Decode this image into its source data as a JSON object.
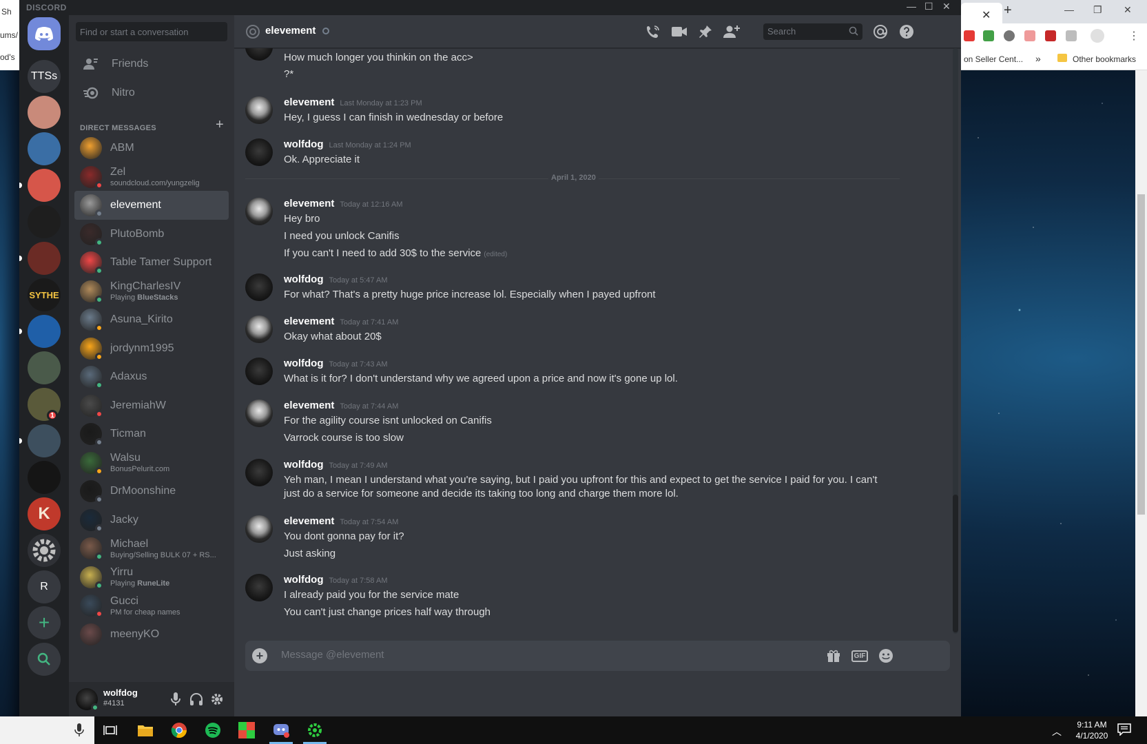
{
  "browser": {
    "tab_text": "Sh",
    "bookmark_left": "ums/",
    "bookmark_left2": "od's",
    "bookmark_seller": "on Seller Cent...",
    "bookmark_more": "»",
    "bookmark_other": "Other bookmarks",
    "ext_colors": [
      "#e53935",
      "#43a047",
      "#757575",
      "#e53935",
      "#c62828",
      "#9e9e9e",
      "#9e9e9e"
    ]
  },
  "discord": {
    "brand": "DISCORD",
    "window_min": "—",
    "window_max": "☐",
    "window_close": "✕"
  },
  "guilds": [
    {
      "name": "home",
      "label": "",
      "color": "#7289da"
    },
    {
      "name": "ttss",
      "label": "TTSs",
      "color": "#36393f"
    },
    {
      "name": "guild-portrait",
      "label": "",
      "color": "#c98a7a"
    },
    {
      "name": "guild-rocket",
      "label": "",
      "color": "#3a6ea5"
    },
    {
      "name": "guild-fish",
      "label": "",
      "color": "#d6564a"
    },
    {
      "name": "guild-check",
      "label": "",
      "color": "#1e1e1e"
    },
    {
      "name": "guild-skull",
      "label": "",
      "color": "#6b2b25"
    },
    {
      "name": "guild-sythe",
      "label": "SYTHE",
      "color": "#1a1a1a"
    },
    {
      "name": "guild-ball",
      "label": "",
      "color": "#1f5fa8"
    },
    {
      "name": "guild-pepe",
      "label": "",
      "color": "#4a5a4a"
    },
    {
      "name": "guild-bird",
      "label": "",
      "color": "#5a5a3a"
    },
    {
      "name": "guild-wave",
      "label": "",
      "color": "#3d4f5e"
    },
    {
      "name": "guild-mask",
      "label": "",
      "color": "#151515"
    },
    {
      "name": "guild-k",
      "label": "K",
      "color": "#c0392b"
    },
    {
      "name": "guild-gear",
      "label": "",
      "color": "#2f3136"
    },
    {
      "name": "guild-r",
      "label": "R",
      "color": "#36393f"
    },
    {
      "name": "add-server",
      "label": "+",
      "color": "#36393f"
    },
    {
      "name": "explore",
      "label": "",
      "color": "#36393f"
    }
  ],
  "guild_badge": "1",
  "dm": {
    "search_placeholder": "Find or start a conversation",
    "friends": "Friends",
    "nitro": "Nitro",
    "header": "DIRECT MESSAGES",
    "add": "+",
    "items": [
      {
        "name": "ABM",
        "sub": "",
        "color": "#f0a030",
        "status": ""
      },
      {
        "name": "Zel",
        "sub": "soundcloud.com/yungzelig",
        "color": "#8a2a2a",
        "status": "#f04747"
      },
      {
        "name": "elevement",
        "sub": "",
        "color": "#9a9a9a",
        "status": "#747f8d"
      },
      {
        "name": "PlutoBomb",
        "sub": "",
        "color": "#3a2a2a",
        "status": "#43b581"
      },
      {
        "name": "Table Tamer Support",
        "sub": "",
        "color": "#f04747",
        "status": "#43b581"
      },
      {
        "name": "KingCharlesIV",
        "sub_prefix": "Playing ",
        "sub_bold": "BlueStacks",
        "color": "#b08a5a",
        "status": "#43b581"
      },
      {
        "name": "Asuna_Kirito",
        "sub": "",
        "color": "#6a7a8a",
        "status": "#faa61a"
      },
      {
        "name": "jordynm1995",
        "sub": "",
        "color": "#faa61a",
        "status": "#faa61a"
      },
      {
        "name": "Adaxus",
        "sub": "",
        "color": "#5a6a7a",
        "status": "#43b581"
      },
      {
        "name": "JeremiahW",
        "sub": "",
        "color": "#4a4a4a",
        "status": "#f04747"
      },
      {
        "name": "Ticman",
        "sub": "",
        "color": "#1a1a1a",
        "status": "#747f8d"
      },
      {
        "name": "Walsu",
        "sub": "BonusPelurit.com",
        "color": "#3a6a3a",
        "status": "#faa61a"
      },
      {
        "name": "DrMoonshine",
        "sub": "",
        "color": "#1a1a1a",
        "status": "#747f8d"
      },
      {
        "name": "Jacky",
        "sub": "",
        "color": "#1a2a3a",
        "status": "#747f8d"
      },
      {
        "name": "Michael",
        "sub": "Buying/Selling BULK 07 + RS...",
        "color": "#7a5a4a",
        "status": "#43b581"
      },
      {
        "name": "Yirru",
        "sub_prefix": "Playing ",
        "sub_bold": "RuneLite",
        "color": "#c8b050",
        "status": "#43b581"
      },
      {
        "name": "Gucci",
        "sub": "PM for cheap names",
        "color": "#3a4a5a",
        "status": "#f04747"
      },
      {
        "name": "meenyKO",
        "sub": "",
        "color": "#6a4a4a",
        "status": ""
      }
    ]
  },
  "user": {
    "name": "wolfdog",
    "tag": "#4131"
  },
  "chat": {
    "title": "elevement",
    "search_placeholder": "Search",
    "composer_placeholder": "Message @elevement",
    "gif_label": "GIF",
    "date_divider": "April 1, 2020",
    "edited": "(edited)",
    "pre_lines": [
      "How much longer you thinkin on the acc>",
      "?*"
    ],
    "messages": [
      {
        "user": "elevement",
        "time": "Last Monday at 1:23 PM",
        "avatar": "skull",
        "lines": [
          "Hey, I guess I can finish in wednesday or before"
        ]
      },
      {
        "user": "wolfdog",
        "time": "Last Monday at 1:24 PM",
        "avatar": "wolf",
        "lines": [
          "Ok. Appreciate it"
        ]
      },
      {
        "user": "elevement",
        "time": "Today at 12:16 AM",
        "avatar": "skull",
        "lines": [
          "Hey bro",
          "I need you unlock Canifis",
          "If you can't I need to add 30$ to the service"
        ]
      },
      {
        "user": "wolfdog",
        "time": "Today at 5:47 AM",
        "avatar": "wolf",
        "lines": [
          "For what? That's a pretty huge price increase lol. Especially when I payed upfront"
        ]
      },
      {
        "user": "elevement",
        "time": "Today at 7:41 AM",
        "avatar": "skull",
        "lines": [
          "Okay what about 20$"
        ]
      },
      {
        "user": "wolfdog",
        "time": "Today at 7:43 AM",
        "avatar": "wolf",
        "lines": [
          "What is it for? I don't understand why we agreed upon a price and now it's gone up lol."
        ]
      },
      {
        "user": "elevement",
        "time": "Today at 7:44 AM",
        "avatar": "skull",
        "lines": [
          "For the agility course isnt unlocked on Canifis",
          "Varrock course is too slow"
        ]
      },
      {
        "user": "wolfdog",
        "time": "Today at 7:49 AM",
        "avatar": "wolf",
        "lines": [
          "Yeh man, I mean I understand what you're saying, but I paid you upfront for this and expect to get the service I paid for you. I can't just do a service for someone and decide its taking too long and charge them more lol."
        ]
      },
      {
        "user": "elevement",
        "time": "Today at 7:54 AM",
        "avatar": "skull",
        "lines": [
          "You dont gonna pay for it?",
          "Just asking"
        ]
      },
      {
        "user": "wolfdog",
        "time": "Today at 7:58 AM",
        "avatar": "wolf",
        "lines": [
          "I already paid you for the service mate",
          "You can't just change prices half way through"
        ]
      }
    ]
  },
  "taskbar": {
    "time": "9:11 AM",
    "date": "4/1/2020"
  }
}
